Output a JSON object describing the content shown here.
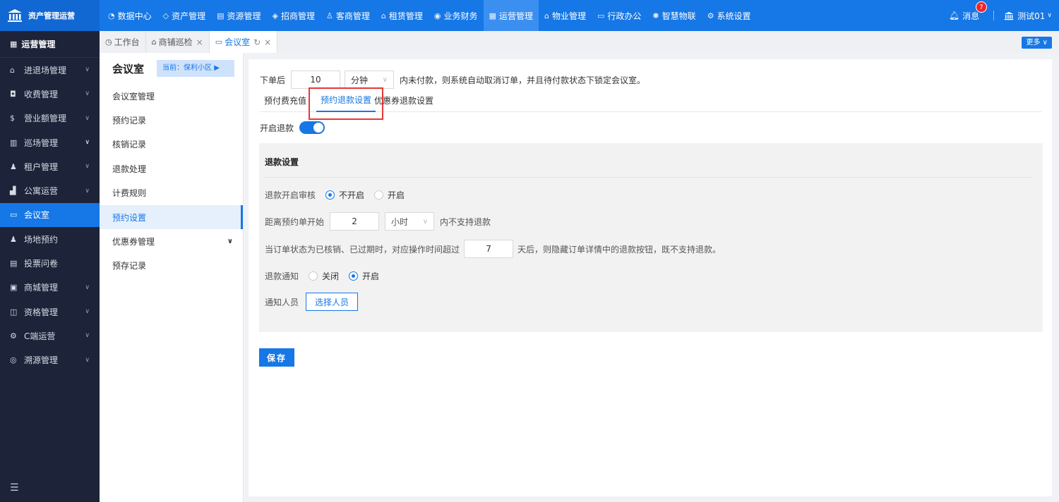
{
  "app": {
    "logo_text": "资产管理运营"
  },
  "topnav": [
    {
      "label": "数据中心",
      "icon": "chart-icon"
    },
    {
      "label": "资产管理",
      "icon": "cube-icon"
    },
    {
      "label": "资源管理",
      "icon": "building-icon"
    },
    {
      "label": "招商管理",
      "icon": "tag-icon"
    },
    {
      "label": "客商管理",
      "icon": "people-icon"
    },
    {
      "label": "租赁管理",
      "icon": "home-icon"
    },
    {
      "label": "业务财务",
      "icon": "coin-icon"
    },
    {
      "label": "运营管理",
      "icon": "grid-icon",
      "active": true
    },
    {
      "label": "物业管理",
      "icon": "house-icon"
    },
    {
      "label": "行政办公",
      "icon": "monitor-icon"
    },
    {
      "label": "智慧物联",
      "icon": "iot-icon"
    },
    {
      "label": "系统设置",
      "icon": "gear-icon"
    }
  ],
  "topright": {
    "msg_label": "消息",
    "msg_count": "7",
    "user": "测试01"
  },
  "sidebar": {
    "head": "运营管理",
    "items": [
      {
        "label": "进退场管理",
        "chev": true
      },
      {
        "label": "收费管理",
        "chev": true
      },
      {
        "label": "营业额管理",
        "chev": true
      },
      {
        "label": "巡场管理",
        "chev": true
      },
      {
        "label": "租户管理",
        "chev": true
      },
      {
        "label": "公寓运营",
        "chev": true
      },
      {
        "label": "会议室",
        "chev": false,
        "active": true
      },
      {
        "label": "场地预约",
        "chev": false
      },
      {
        "label": "投票问卷",
        "chev": false
      },
      {
        "label": "商城管理",
        "chev": true
      },
      {
        "label": "资格管理",
        "chev": true
      },
      {
        "label": "C端运营",
        "chev": true
      },
      {
        "label": "溯源管理",
        "chev": true
      }
    ]
  },
  "tabs": [
    {
      "label": "工作台"
    },
    {
      "label": "商铺巡检"
    },
    {
      "label": "会议室",
      "active": true
    }
  ],
  "more_label": "更多",
  "subpanel": {
    "title": "会议室",
    "current": "当前：保利小区 ▶",
    "items": [
      {
        "label": "会议室管理"
      },
      {
        "label": "预约记录"
      },
      {
        "label": "核销记录"
      },
      {
        "label": "退款处理"
      },
      {
        "label": "计费规则"
      },
      {
        "label": "预约设置",
        "active": true
      },
      {
        "label": "优惠券管理",
        "chev": true
      },
      {
        "label": "预存记录"
      }
    ]
  },
  "main": {
    "order_prefix": "下单后",
    "order_minutes": "10",
    "order_unit": "分钟",
    "order_suffix": "内未付款，则系统自动取消订单，并且待付款状态下锁定会议室。",
    "tabs": [
      "预付费充值",
      "预约退款设置",
      "优惠券退款设置"
    ],
    "refund_toggle_label": "开启退款",
    "refund_toggle_on": true,
    "section_title": "退款设置",
    "audit_label": "退款开启审核",
    "audit_opt_off": "不开启",
    "audit_opt_on": "开启",
    "distance_label": "距离预约单开始",
    "distance_value": "2",
    "distance_unit": "小时",
    "distance_suffix": "内不支持退款",
    "status_label": "当订单状态为已核销、已过期时，对应操作时间超过",
    "status_days": "7",
    "status_suffix": "天后，则隐藏订单详情中的退款按钮，既不支持退款。",
    "notify_label": "退款通知",
    "notify_off": "关闭",
    "notify_on": "开启",
    "notify_person_label": "通知人员",
    "select_person": "选择人员",
    "save": "保存"
  }
}
